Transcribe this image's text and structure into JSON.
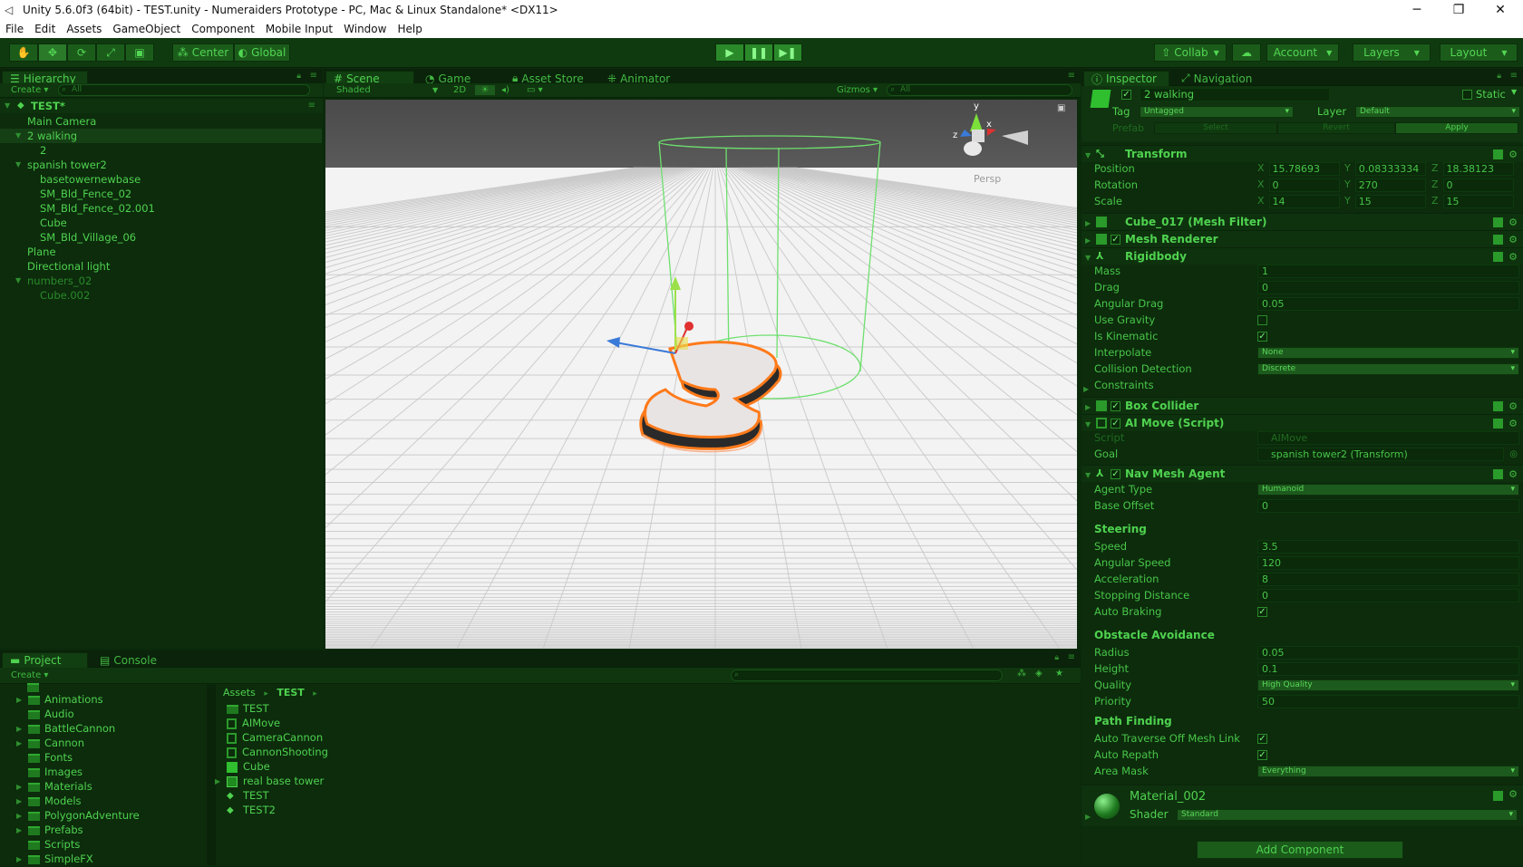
{
  "window": {
    "title": "Unity 5.6.0f3 (64bit) - TEST.unity - Numeraiders Prototype - PC, Mac & Linux Standalone* <DX11>"
  },
  "menu": [
    "File",
    "Edit",
    "Assets",
    "GameObject",
    "Component",
    "Mobile Input",
    "Window",
    "Help"
  ],
  "toolbar": {
    "center": "Center",
    "global": "Global",
    "collab": "Collab",
    "account": "Account",
    "layers": "Layers",
    "layout": "Layout"
  },
  "hierarchy": {
    "tab": "Hierarchy",
    "create": "Create",
    "search": "All",
    "scene": "TEST*",
    "items": [
      {
        "label": "Main Camera",
        "indent": 1
      },
      {
        "label": "2 walking",
        "indent": 1,
        "selected": true
      },
      {
        "label": "2",
        "indent": 2
      },
      {
        "label": "spanish tower2",
        "indent": 1
      },
      {
        "label": "basetowernewbase",
        "indent": 2
      },
      {
        "label": "SM_Bld_Fence_02",
        "indent": 2
      },
      {
        "label": "SM_Bld_Fence_02.001",
        "indent": 2
      },
      {
        "label": "Cube",
        "indent": 2
      },
      {
        "label": "SM_Bld_Village_06",
        "indent": 2
      },
      {
        "label": "Plane",
        "indent": 1
      },
      {
        "label": "Directional light",
        "indent": 1
      },
      {
        "label": "numbers_02",
        "indent": 1,
        "dim": true
      },
      {
        "label": "Cube.002",
        "indent": 2,
        "dim": true
      }
    ]
  },
  "sceneview": {
    "tabs": [
      "Scene",
      "Game",
      "Asset Store",
      "Animator"
    ],
    "shading": "Shaded",
    "mode2d": "2D",
    "gizmos": "Gizmos",
    "search": "All",
    "persp": "Persp",
    "axis_y": "y",
    "axis_x": "x",
    "axis_z": "z"
  },
  "inspector": {
    "tabs": [
      "Inspector",
      "Navigation"
    ],
    "object_name": "2 walking",
    "static": "Static",
    "tag_label": "Tag",
    "tag": "Untagged",
    "layer_label": "Layer",
    "layer": "Default",
    "prefab": "Prefab",
    "select": "Select",
    "revert": "Revert",
    "apply": "Apply",
    "transform": {
      "title": "Transform",
      "rows": [
        {
          "label": "Position",
          "x": "15.78693",
          "y": "0.08333334",
          "z": "18.38123"
        },
        {
          "label": "Rotation",
          "x": "0",
          "y": "270",
          "z": "0"
        },
        {
          "label": "Scale",
          "x": "14",
          "y": "15",
          "z": "15"
        }
      ]
    },
    "mesh_filter": "Cube_017 (Mesh Filter)",
    "mesh_renderer": "Mesh Renderer",
    "rigidbody": {
      "title": "Rigidbody",
      "mass_label": "Mass",
      "mass": "1",
      "drag_label": "Drag",
      "drag": "0",
      "angular_drag_label": "Angular Drag",
      "angular_drag": "0.05",
      "use_gravity_label": "Use Gravity",
      "is_kinematic_label": "Is Kinematic",
      "interpolate_label": "Interpolate",
      "interpolate": "None",
      "collision_label": "Collision Detection",
      "collision": "Discrete",
      "constraints_label": "Constraints"
    },
    "box_collider": "Box Collider",
    "ai_move": {
      "title": "AI Move (Script)",
      "script_label": "Script",
      "script": "AIMove",
      "goal_label": "Goal",
      "goal": "spanish tower2 (Transform)"
    },
    "nav_agent": {
      "title": "Nav Mesh Agent",
      "agent_type_label": "Agent Type",
      "agent_type": "Humanoid",
      "base_offset_label": "Base Offset",
      "base_offset": "0",
      "steering": "Steering",
      "speed_label": "Speed",
      "speed": "3.5",
      "angular_speed_label": "Angular Speed",
      "angular_speed": "120",
      "accel_label": "Acceleration",
      "accel": "8",
      "stopping_label": "Stopping Distance",
      "stopping": "0",
      "auto_braking_label": "Auto Braking",
      "obstacle": "Obstacle Avoidance",
      "radius_label": "Radius",
      "radius": "0.05",
      "height_label": "Height",
      "height": "0.1",
      "quality_label": "Quality",
      "quality": "High Quality",
      "priority_label": "Priority",
      "priority": "50",
      "pathfinding": "Path Finding",
      "auto_traverse_label": "Auto Traverse Off Mesh Link",
      "auto_repath_label": "Auto Repath",
      "area_mask_label": "Area Mask",
      "area_mask": "Everything"
    },
    "material": {
      "name": "Material_002",
      "shader_label": "Shader",
      "shader": "Standard"
    },
    "add_component": "Add Component"
  },
  "project": {
    "tabs": [
      "Project",
      "Console"
    ],
    "create": "Create",
    "folders": [
      "Animations",
      "Audio",
      "BattleCannon",
      "Cannon",
      "Fonts",
      "Images",
      "Materials",
      "Models",
      "PolygonAdventure",
      "Prefabs",
      "Scripts",
      "SimpleFX"
    ],
    "breadcrumb": [
      "Assets",
      "TEST"
    ],
    "assets": [
      {
        "label": "TEST",
        "kind": "folder"
      },
      {
        "label": "AIMove",
        "kind": "script"
      },
      {
        "label": "CameraCannon",
        "kind": "script"
      },
      {
        "label": "CannonShooting",
        "kind": "script"
      },
      {
        "label": "Cube",
        "kind": "prefab"
      },
      {
        "label": "real base tower",
        "kind": "model"
      },
      {
        "label": "TEST",
        "kind": "scene"
      },
      {
        "label": "TEST2",
        "kind": "scene"
      }
    ]
  }
}
